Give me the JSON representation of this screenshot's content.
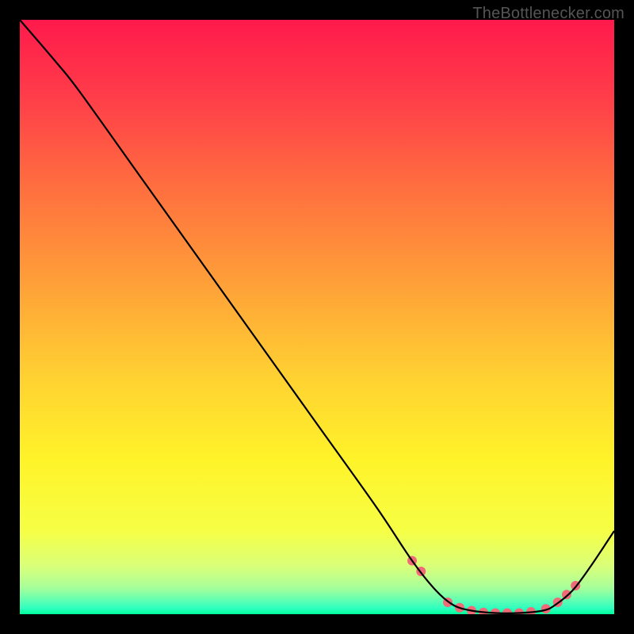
{
  "watermark": "TheBottlenecker.com",
  "chart_data": {
    "type": "line",
    "title": "",
    "xlabel": "",
    "ylabel": "",
    "xlim": [
      0,
      100
    ],
    "ylim": [
      0,
      100
    ],
    "grid": false,
    "background_gradient": {
      "stops": [
        {
          "offset": 0.0,
          "color": "#ff1a4b"
        },
        {
          "offset": 0.12,
          "color": "#ff3a4a"
        },
        {
          "offset": 0.28,
          "color": "#ff6e3f"
        },
        {
          "offset": 0.45,
          "color": "#ffa238"
        },
        {
          "offset": 0.6,
          "color": "#ffd132"
        },
        {
          "offset": 0.74,
          "color": "#fff329"
        },
        {
          "offset": 0.86,
          "color": "#f6ff45"
        },
        {
          "offset": 0.92,
          "color": "#d9ff7a"
        },
        {
          "offset": 0.955,
          "color": "#a8ff9a"
        },
        {
          "offset": 0.975,
          "color": "#66ffb0"
        },
        {
          "offset": 0.99,
          "color": "#2effc0"
        },
        {
          "offset": 1.0,
          "color": "#00ff99"
        }
      ]
    },
    "series": [
      {
        "name": "curve",
        "color": "#000000",
        "x": [
          0,
          6,
          10,
          20,
          30,
          40,
          50,
          60,
          66,
          70,
          73,
          76,
          80,
          84,
          88,
          90,
          93,
          96,
          100
        ],
        "y": [
          100,
          93,
          88,
          74,
          60,
          46,
          32,
          18,
          9,
          4,
          1.5,
          0.6,
          0.2,
          0.2,
          0.6,
          1.5,
          4,
          8,
          14
        ]
      }
    ],
    "markers": {
      "name": "highlight-dots",
      "color": "#f06a78",
      "radius": 6,
      "x": [
        66,
        67.5,
        72,
        74,
        76,
        78,
        80,
        82,
        84,
        86,
        88.5,
        90.5,
        92,
        93.5
      ],
      "y": [
        9,
        7.2,
        2.0,
        1.1,
        0.6,
        0.3,
        0.2,
        0.2,
        0.2,
        0.4,
        0.9,
        2.0,
        3.3,
        4.8
      ]
    }
  }
}
